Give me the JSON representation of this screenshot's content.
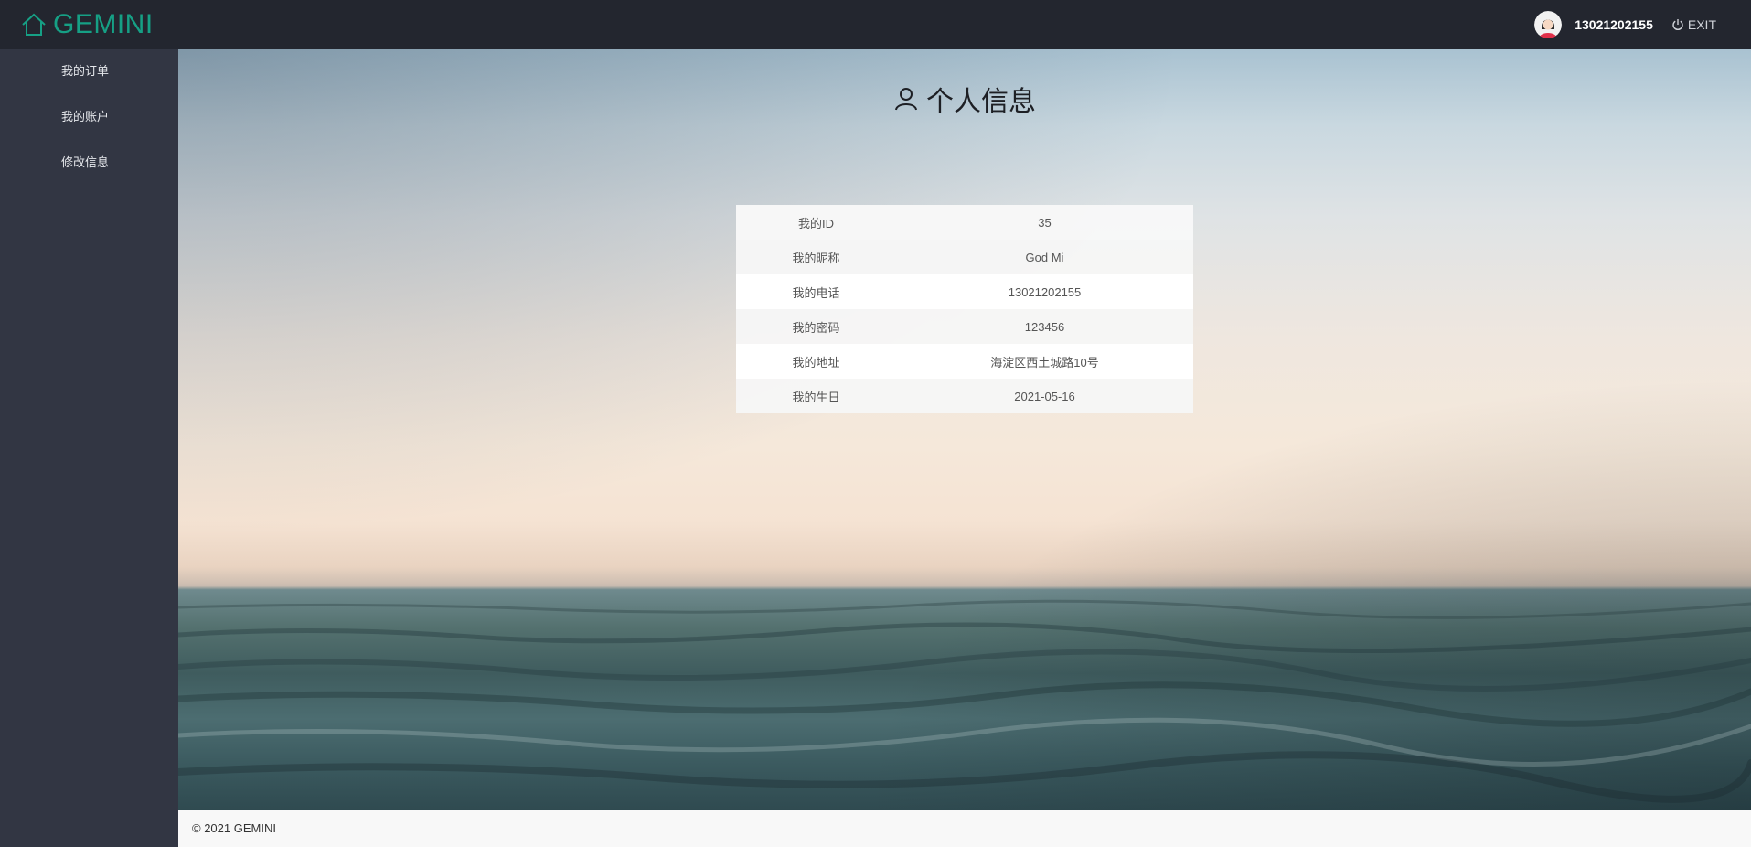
{
  "header": {
    "brand": "GEMINI",
    "username": "13021202155",
    "exit_label": "EXIT",
    "brand_color": "#16a085"
  },
  "sidebar": {
    "items": [
      {
        "label": "我的订单"
      },
      {
        "label": "我的账户"
      },
      {
        "label": "修改信息"
      }
    ]
  },
  "main": {
    "title": "个人信息",
    "rows": [
      {
        "key": "我的ID",
        "value": "35"
      },
      {
        "key": "我的昵称",
        "value": "God Mi"
      },
      {
        "key": "我的电话",
        "value": "13021202155"
      },
      {
        "key": "我的密码",
        "value": "123456"
      },
      {
        "key": "我的地址",
        "value": "海淀区西土城路10号"
      },
      {
        "key": "我的生日",
        "value": "2021-05-16"
      }
    ]
  },
  "footer": {
    "copyright": "© 2021 GEMINI"
  }
}
